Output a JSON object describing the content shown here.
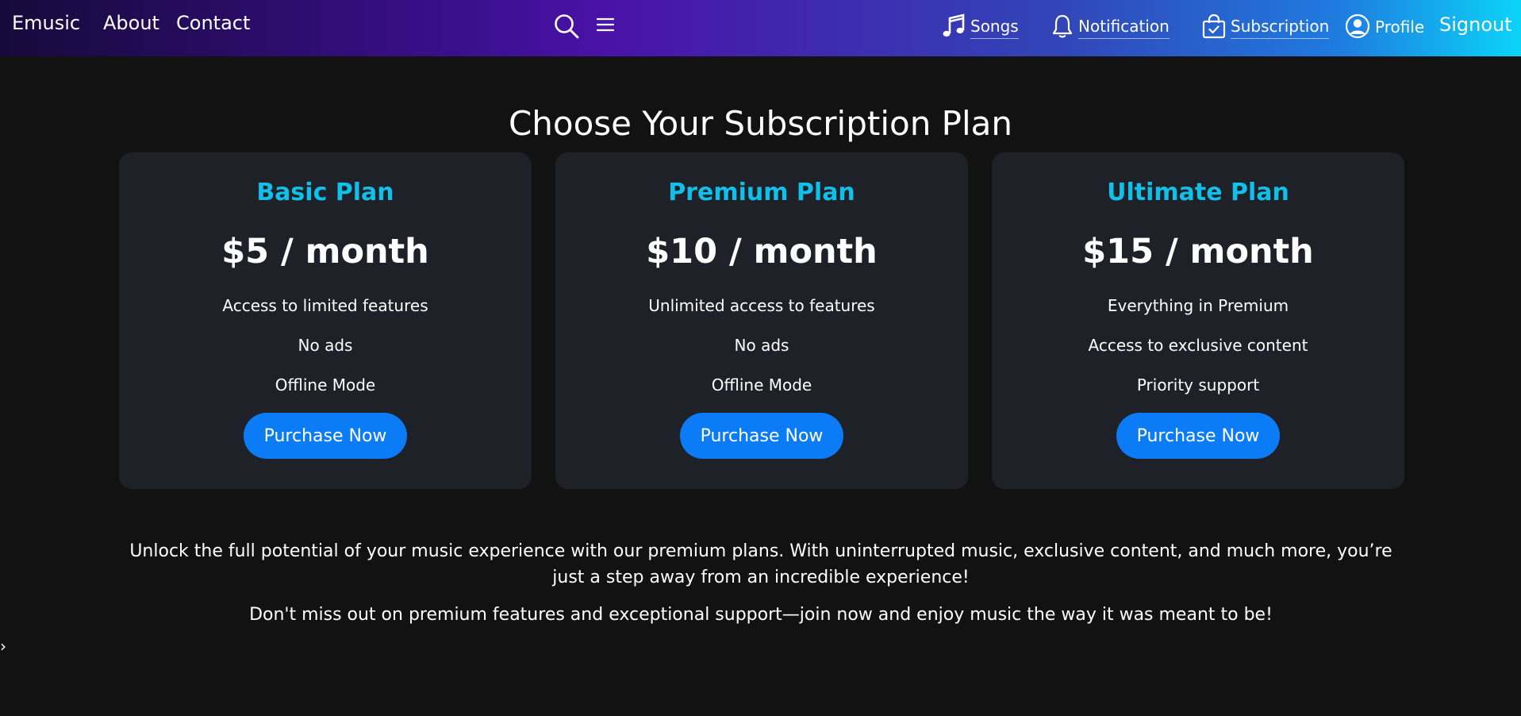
{
  "nav": {
    "brand": "Emusic",
    "about": "About",
    "contact": "Contact",
    "search_icon": "search-icon",
    "menu_icon": "hamburger-menu-icon",
    "songs": "Songs",
    "notification": "Notification",
    "subscription": "Subscription",
    "profile": "Profile",
    "signout": "Signout"
  },
  "page": {
    "title": "Choose Your Subscription Plan"
  },
  "plans": [
    {
      "name": "Basic Plan",
      "price": "$5 / month",
      "features": [
        "Access to limited features",
        "No ads",
        "Offline Mode"
      ],
      "button": "Purchase Now"
    },
    {
      "name": "Premium Plan",
      "price": "$10 / month",
      "features": [
        "Unlimited access to features",
        "No ads",
        "Offline Mode"
      ],
      "button": "Purchase Now"
    },
    {
      "name": "Ultimate Plan",
      "price": "$15 / month",
      "features": [
        "Everything in Premium",
        "Access to exclusive content",
        "Priority support"
      ],
      "button": "Purchase Now"
    }
  ],
  "footer": {
    "paragraph1": "Unlock the full potential of your music experience with our premium plans. With uninterrupted music, exclusive content, and much more, you’re just a step away from an incredible experience!",
    "paragraph2": "Don't miss out on premium features and exceptional support—join now and enjoy music the way it was meant to be!",
    "toggle": "›"
  },
  "colors": {
    "background": "#121212",
    "card": "#1e2128",
    "accent": "#12bfe8",
    "button": "#0b7bf6"
  }
}
